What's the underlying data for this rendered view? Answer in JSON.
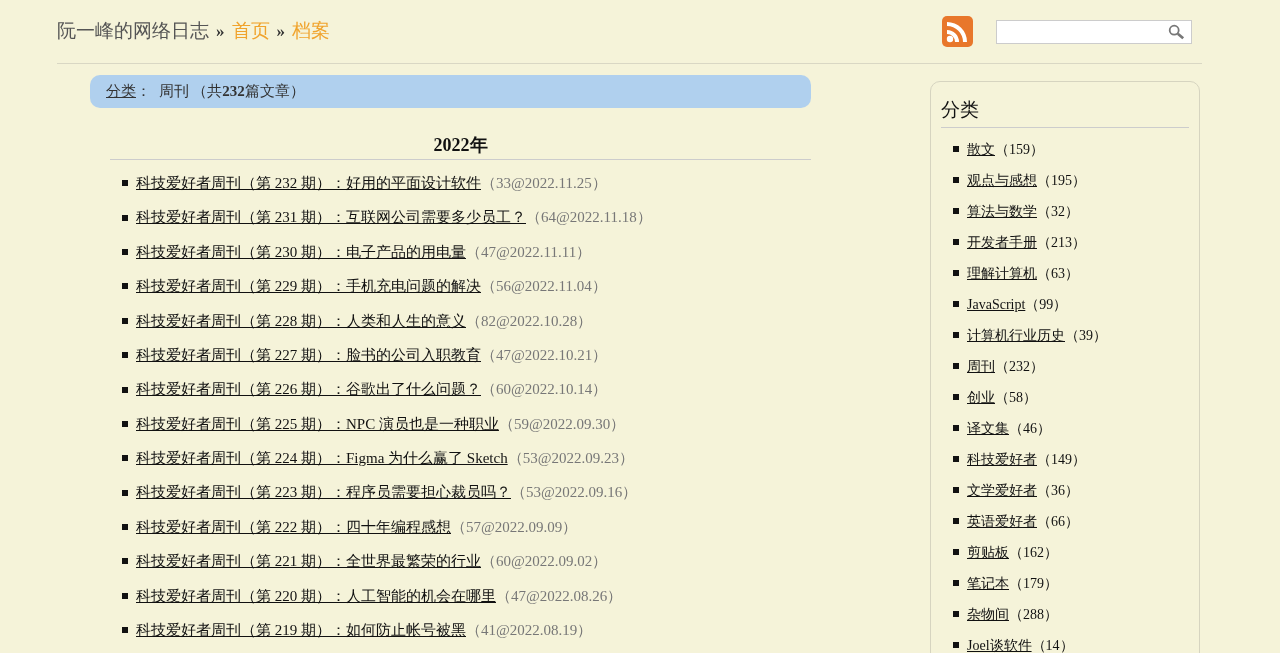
{
  "header": {
    "site_title": "阮一峰的网络日志",
    "separator": "»",
    "breadcrumbs": [
      {
        "label": "首页"
      },
      {
        "label": "档案"
      }
    ]
  },
  "category_bar": {
    "link": "分类",
    "text": "：  周刊 （共**232**篇文章）"
  },
  "archive": {
    "year": "2022年",
    "posts": [
      {
        "title": "科技爱好者周刊（第 232 期）：好用的平面设计软件",
        "meta": "（33@2022.11.25）"
      },
      {
        "title": "科技爱好者周刊（第 231 期）：互联网公司需要多少员工？",
        "meta": "（64@2022.11.18）"
      },
      {
        "title": "科技爱好者周刊（第 230 期）：电子产品的用电量",
        "meta": "（47@2022.11.11）"
      },
      {
        "title": "科技爱好者周刊（第 229 期）：手机充电问题的解决",
        "meta": "（56@2022.11.04）"
      },
      {
        "title": "科技爱好者周刊（第 228 期）：人类和人生的意义",
        "meta": "（82@2022.10.28）"
      },
      {
        "title": "科技爱好者周刊（第 227 期）：脸书的公司入职教育",
        "meta": "（47@2022.10.21）"
      },
      {
        "title": "科技爱好者周刊（第 226 期）：谷歌出了什么问题？",
        "meta": "（60@2022.10.14）"
      },
      {
        "title": "科技爱好者周刊（第 225 期）：NPC 演员也是一种职业",
        "meta": "（59@2022.09.30）"
      },
      {
        "title": "科技爱好者周刊（第 224 期）：Figma 为什么赢了 Sketch",
        "meta": "（53@2022.09.23）"
      },
      {
        "title": "科技爱好者周刊（第 223 期）：程序员需要担心裁员吗？",
        "meta": "（53@2022.09.16）"
      },
      {
        "title": "科技爱好者周刊（第 222 期）：四十年编程感想",
        "meta": "（57@2022.09.09）"
      },
      {
        "title": "科技爱好者周刊（第 221 期）：全世界最繁荣的行业",
        "meta": "（60@2022.09.02）"
      },
      {
        "title": "科技爱好者周刊（第 220 期）：人工智能的机会在哪里",
        "meta": "（47@2022.08.26）"
      },
      {
        "title": "科技爱好者周刊（第 219 期）：如何防止帐号被黑",
        "meta": "（41@2022.08.19）"
      }
    ]
  },
  "sidebar": {
    "title": "分类",
    "items": [
      {
        "name": "散文",
        "count": "（159）"
      },
      {
        "name": "观点与感想",
        "count": "（195）"
      },
      {
        "name": "算法与数学",
        "count": "（32）"
      },
      {
        "name": "开发者手册",
        "count": "（213）"
      },
      {
        "name": "理解计算机",
        "count": "（63）"
      },
      {
        "name": "JavaScript",
        "count": "（99）"
      },
      {
        "name": "计算机行业历史",
        "count": "（39）"
      },
      {
        "name": "周刊",
        "count": "（232）"
      },
      {
        "name": "创业",
        "count": "（58）"
      },
      {
        "name": "译文集",
        "count": "（46）"
      },
      {
        "name": "科技爱好者",
        "count": "（149）"
      },
      {
        "name": "文学爱好者",
        "count": "（36）"
      },
      {
        "name": "英语爱好者",
        "count": "（66）"
      },
      {
        "name": "剪贴板",
        "count": "（162）"
      },
      {
        "name": "笔记本",
        "count": "（179）"
      },
      {
        "name": "杂物间",
        "count": "（288）"
      },
      {
        "name": "Joel谈软件",
        "count": "（14）"
      }
    ]
  }
}
